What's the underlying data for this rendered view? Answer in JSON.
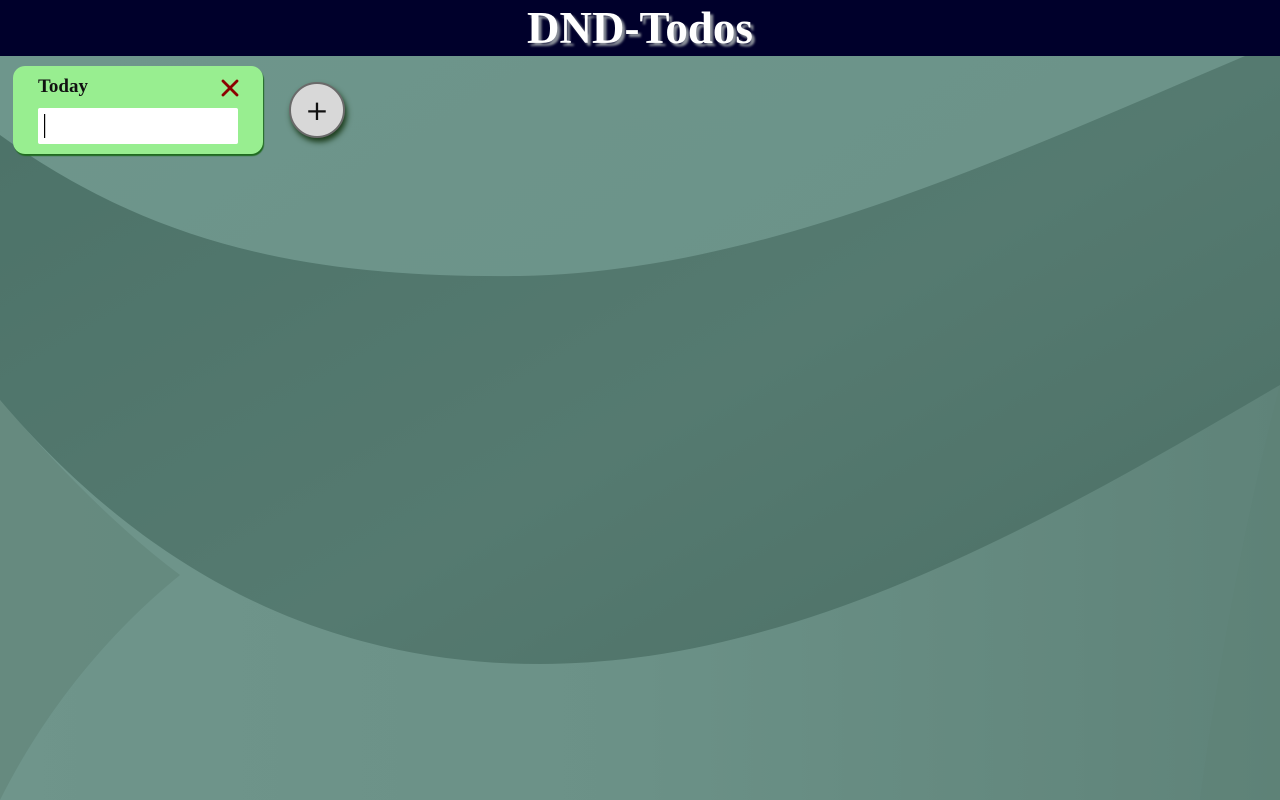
{
  "app": {
    "title": "DND-Todos"
  },
  "colors": {
    "header_bg": "#00002b",
    "card_bg": "#98ee90",
    "close_icon": "#8b0000",
    "board_bg": "#5b7d73"
  },
  "cards": [
    {
      "title": "Today",
      "input_value": "",
      "close_icon": "close-icon"
    }
  ],
  "add_button": {
    "icon": "plus-icon",
    "label": "+"
  }
}
